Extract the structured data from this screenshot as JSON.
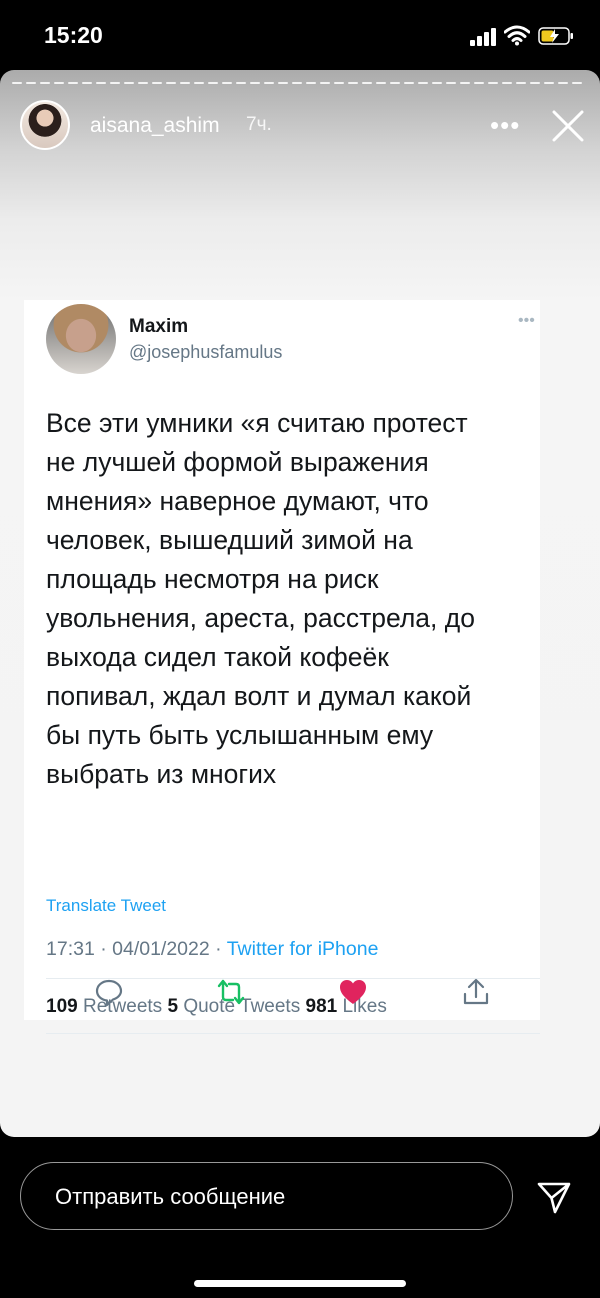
{
  "status_bar": {
    "time": "15:20",
    "icons": [
      "cellular-signal-icon",
      "wifi-icon",
      "battery-charging-icon"
    ],
    "battery_color": "#f0c91f"
  },
  "story": {
    "username": "aisana_ashim",
    "time_ago": "7ч.",
    "more_icon": "more-horizontal-icon",
    "close_icon": "close-icon"
  },
  "tweet": {
    "author_name": "Maxim",
    "author_handle": "@josephusfamulus",
    "text_lines": [
      "Все эти умники «я считаю протест",
      "не лучшей формой выражения",
      "мнения» наверное думают, что",
      "человек, вышедший зимой на",
      "площадь несмотря на риск",
      "увольнения, ареста, расстрела, до",
      "выхода сидел такой кофеёк",
      "попивал, ждал волт и думал какой",
      "бы путь быть услышанным ему",
      "выбрать из многих"
    ],
    "translate_label": "Translate Tweet",
    "timestamp": "17:31 · 04/01/2022 · ",
    "source": "Twitter for iPhone",
    "retweets_count": "109",
    "retweets_label": " Retweets ",
    "quotes_count": "5",
    "quotes_label": " Quote Tweets ",
    "likes_count": "981",
    "likes_label": " Likes",
    "colors": {
      "link": "#1da1f2",
      "retweet": "#17bf63",
      "like": "#e0245e",
      "muted": "#657786"
    }
  },
  "actions": [
    "reply-icon",
    "retweet-icon",
    "like-icon",
    "share-icon"
  ],
  "reply_bar": {
    "placeholder": "Отправить сообщение",
    "send_icon": "send-icon"
  }
}
